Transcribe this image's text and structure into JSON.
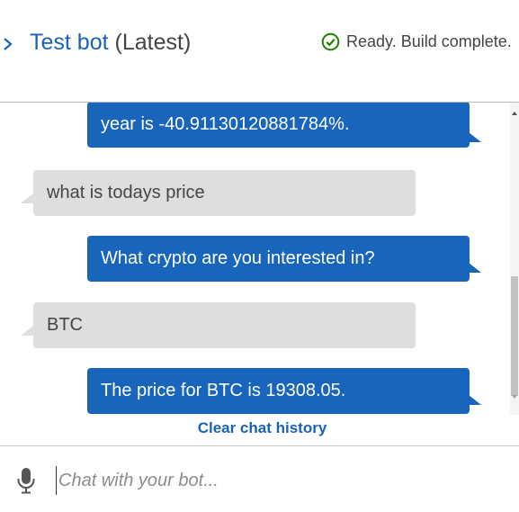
{
  "header": {
    "bot_name": "Test bot",
    "version": "(Latest)",
    "status_text": "Ready. Build complete.",
    "status_color": "#1d8102",
    "accent_color": "#1a62b6",
    "icons": {
      "expand": "chevron-right-icon",
      "status": "check-circle-icon"
    }
  },
  "chat": {
    "messages": [
      {
        "sender": "bot",
        "text": "year is -40.91130120881784%."
      },
      {
        "sender": "user",
        "text": "what is todays price"
      },
      {
        "sender": "bot",
        "text": "What crypto are you interested in?"
      },
      {
        "sender": "user",
        "text": "BTC"
      },
      {
        "sender": "bot",
        "text": "The price for BTC is 19308.05."
      }
    ],
    "bot_bubble_color": "#1865bb",
    "user_bubble_color": "#dedede"
  },
  "actions": {
    "clear_label": "Clear chat history"
  },
  "composer": {
    "placeholder": "Chat with your bot...",
    "value": "",
    "icon": "microphone-icon"
  }
}
